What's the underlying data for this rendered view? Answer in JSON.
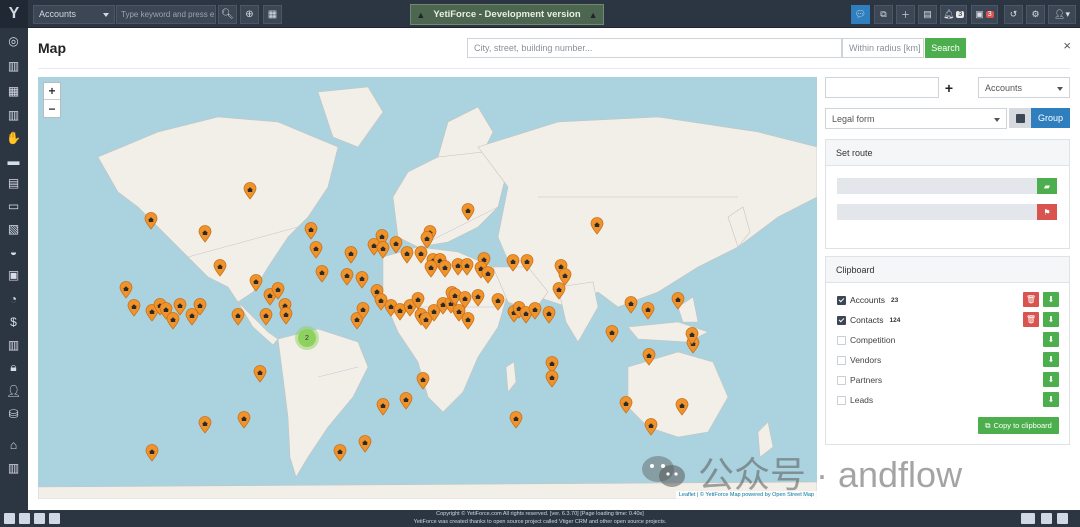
{
  "topbar": {
    "module_select": "Accounts",
    "search_placeholder": "Type keyword and press e",
    "dev_badge": "YetiForce - Development version",
    "notif_count_1": "3",
    "notif_count_2": "3"
  },
  "modal": {
    "title": "Map",
    "address_placeholder": "City, street, building number...",
    "radius_placeholder": "Within radius [km]",
    "search_button": "Search",
    "close": "×"
  },
  "map": {
    "cluster_count": "2",
    "attribution_leaflet": "Leaflet",
    "attribution_rest": "| © YetiForce Map powered by Open Street Map",
    "watermark": "公众号 · andflow"
  },
  "panel": {
    "module_select": "Accounts",
    "field_select": "Legal form",
    "group_button": "Group",
    "route_title": "Set route",
    "clipboard_title": "Clipboard",
    "clipboard_items": [
      {
        "label": "Accounts",
        "count": "23",
        "checked": true
      },
      {
        "label": "Contacts",
        "count": "124",
        "checked": true
      },
      {
        "label": "Competition",
        "count": "",
        "checked": false
      },
      {
        "label": "Vendors",
        "count": "",
        "checked": false
      },
      {
        "label": "Partners",
        "count": "",
        "checked": false
      },
      {
        "label": "Leads",
        "count": "",
        "checked": false
      }
    ],
    "copy_button": "Copy to clipboard"
  },
  "footer": {
    "line1": "Copyright © YetiForce.com All rights reserved. [ver. 6.3.70] [Page loading time: 0.40s]",
    "line2": "YetiForce was created thanks to open source project called Vtiger CRM and other open source projects."
  },
  "colors": {
    "accent_blue": "#2f7fbf",
    "success_green": "#4cae4c",
    "danger_red": "#d9534f",
    "marker_orange": "#f0932b",
    "map_water": "#aad3df",
    "map_land": "#f2efe9"
  }
}
